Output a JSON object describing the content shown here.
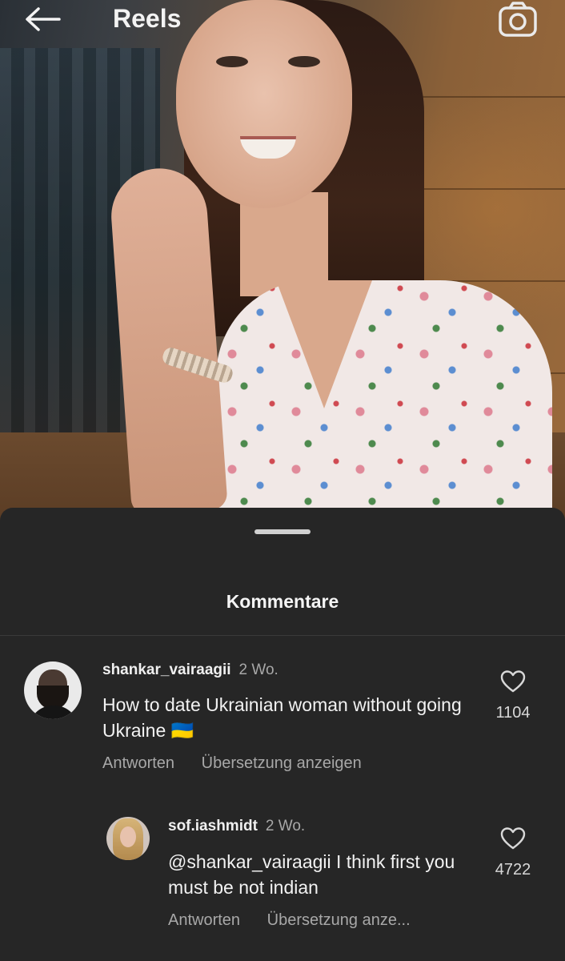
{
  "header": {
    "title": "Reels",
    "back_icon": "arrow-left-icon",
    "camera_icon": "camera-icon"
  },
  "sheet": {
    "title": "Kommentare"
  },
  "comments": [
    {
      "username": "shankar_vairaagii",
      "time": "2 Wo.",
      "text": "How to date Ukrainian woman without going Ukraine 🇺🇦",
      "likes": "1104",
      "reply_label": "Antworten",
      "translate_label": "Übersetzung anzeigen"
    },
    {
      "username": "sof.iashmidt",
      "time": "2 Wo.",
      "mention": "@shankar_vairaagii",
      "text": " I think first you must be not indian",
      "likes": "4722",
      "reply_label": "Antworten",
      "translate_label": "Übersetzung anze..."
    }
  ],
  "colors": {
    "sheet_bg": "#262626",
    "text_primary": "#f2f2f2",
    "text_secondary": "#a8a8a8"
  }
}
